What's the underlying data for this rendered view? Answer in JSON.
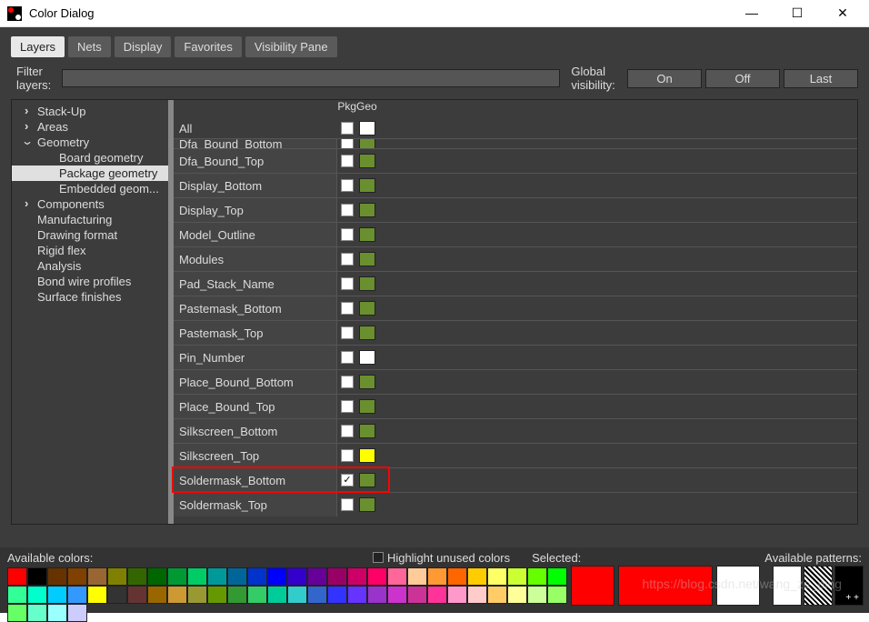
{
  "window": {
    "title": "Color Dialog"
  },
  "tabs": [
    "Layers",
    "Nets",
    "Display",
    "Favorites",
    "Visibility Pane"
  ],
  "activeTab": 0,
  "filter": {
    "label": "Filter layers:",
    "value": ""
  },
  "globalVis": {
    "label": "Global visibility:",
    "buttons": [
      "On",
      "Off",
      "Last"
    ]
  },
  "tree": [
    {
      "label": "Stack-Up",
      "type": "col"
    },
    {
      "label": "Areas",
      "type": "col"
    },
    {
      "label": "Geometry",
      "type": "exp"
    },
    {
      "label": "Board geometry",
      "type": "child"
    },
    {
      "label": "Package geometry",
      "type": "child",
      "selected": true
    },
    {
      "label": "Embedded geom...",
      "type": "child"
    },
    {
      "label": "Components",
      "type": "col"
    },
    {
      "label": "Manufacturing",
      "type": "plain"
    },
    {
      "label": "Drawing format",
      "type": "plain"
    },
    {
      "label": "Rigid flex",
      "type": "plain"
    },
    {
      "label": "Analysis",
      "type": "plain"
    },
    {
      "label": "Bond wire profiles",
      "type": "plain"
    },
    {
      "label": "Surface finishes",
      "type": "plain"
    }
  ],
  "gridHeader": "PkgGeo",
  "headerChecks": {
    "check": false,
    "color": "#ffffff"
  },
  "allRow": "All",
  "rows": [
    {
      "name": "Dfa_Bound_Bottom",
      "check": false,
      "color": "#6a8f2f",
      "partial": true
    },
    {
      "name": "Dfa_Bound_Top",
      "check": false,
      "color": "#6a8f2f"
    },
    {
      "name": "Display_Bottom",
      "check": false,
      "color": "#6a8f2f"
    },
    {
      "name": "Display_Top",
      "check": false,
      "color": "#6a8f2f"
    },
    {
      "name": "Model_Outline",
      "check": false,
      "color": "#6a8f2f"
    },
    {
      "name": "Modules",
      "check": false,
      "color": "#6a8f2f"
    },
    {
      "name": "Pad_Stack_Name",
      "check": false,
      "color": "#6a8f2f"
    },
    {
      "name": "Pastemask_Bottom",
      "check": false,
      "color": "#6a8f2f"
    },
    {
      "name": "Pastemask_Top",
      "check": false,
      "color": "#6a8f2f"
    },
    {
      "name": "Pin_Number",
      "check": false,
      "color": "#ffffff"
    },
    {
      "name": "Place_Bound_Bottom",
      "check": false,
      "color": "#6a8f2f"
    },
    {
      "name": "Place_Bound_Top",
      "check": false,
      "color": "#6a8f2f"
    },
    {
      "name": "Silkscreen_Bottom",
      "check": false,
      "color": "#6a8f2f"
    },
    {
      "name": "Silkscreen_Top",
      "check": false,
      "color": "#ffff00"
    },
    {
      "name": "Soldermask_Bottom",
      "check": true,
      "color": "#6a8f2f",
      "highlight": true
    },
    {
      "name": "Soldermask_Top",
      "check": false,
      "color": "#6a8f2f"
    }
  ],
  "footer": {
    "available": "Available colors:",
    "highlight": "Highlight unused colors",
    "selected": "Selected:",
    "patterns": "Available patterns:"
  },
  "palette": [
    "#ff0000",
    "#000000",
    "#663300",
    "#804000",
    "#996633",
    "#808000",
    "#336600",
    "#006600",
    "#009933",
    "#00cc66",
    "#009999",
    "#006699",
    "#0033cc",
    "#0000ff",
    "#3300cc",
    "#660099",
    "#990066",
    "#cc0066",
    "#ff0066",
    "#ff6699",
    "#ffcc99",
    "#ff9933",
    "#ff6600",
    "#ffcc00",
    "#ffff66",
    "#ccff33",
    "#66ff00",
    "#00ff00",
    "#33ff99",
    "#00ffcc",
    "#00ccff",
    "#3399ff",
    "#ffff00",
    "#333333",
    "#663333",
    "#996600",
    "#cc9933",
    "#999933",
    "#669900",
    "#339933",
    "#33cc66",
    "#00cc99",
    "#33cccc",
    "#3366cc",
    "#3333ff",
    "#6633ff",
    "#9933cc",
    "#cc33cc",
    "#cc3399",
    "#ff3399",
    "#ff99cc",
    "#ffcccc",
    "#ffcc66",
    "#ffff99",
    "#ccff99",
    "#99ff66",
    "#66ff66",
    "#66ffcc",
    "#99ffff",
    "#ccccff"
  ],
  "selectedColors": [
    "#ff0000",
    "#ff0000",
    "#ffffff"
  ],
  "watermark": "https://blog.csdn.net/wang_ze_ping"
}
